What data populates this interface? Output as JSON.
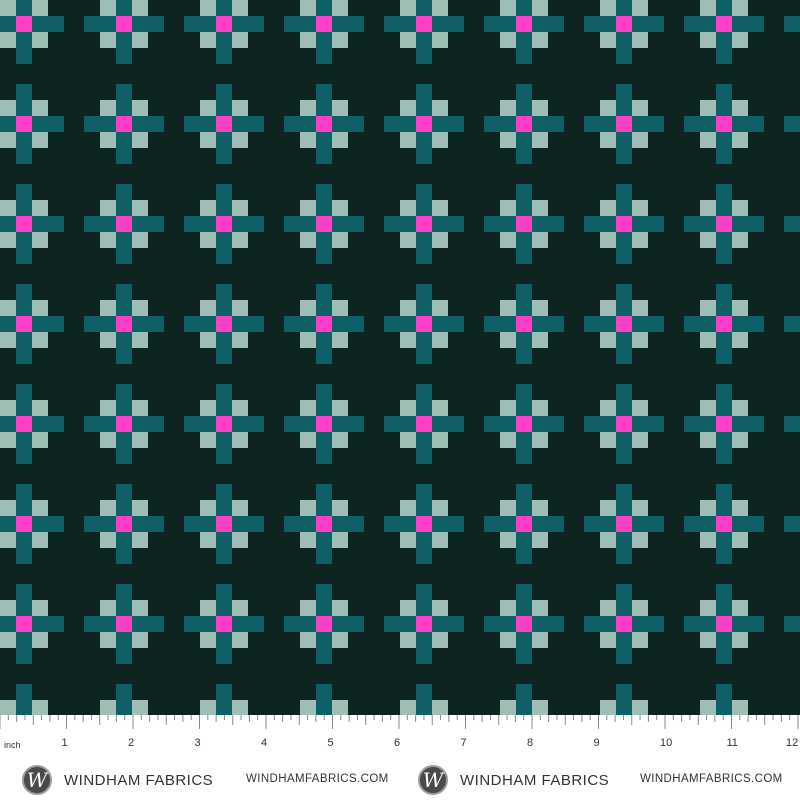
{
  "fabric": {
    "colors": {
      "background": "#0d2420",
      "light": "#9ebdb4",
      "teal": "#0f6066",
      "pink": "#ff3ec8"
    }
  },
  "selvage": {
    "ruler_unit": "inch",
    "ruler_numbers": [
      "1",
      "2",
      "3",
      "4",
      "5",
      "6",
      "7",
      "8",
      "9",
      "10",
      "11",
      "12"
    ],
    "brand_name": "WINDHAM FABRICS",
    "website": "WINDHAMFABRICS.COM",
    "logo_letter": "W"
  }
}
